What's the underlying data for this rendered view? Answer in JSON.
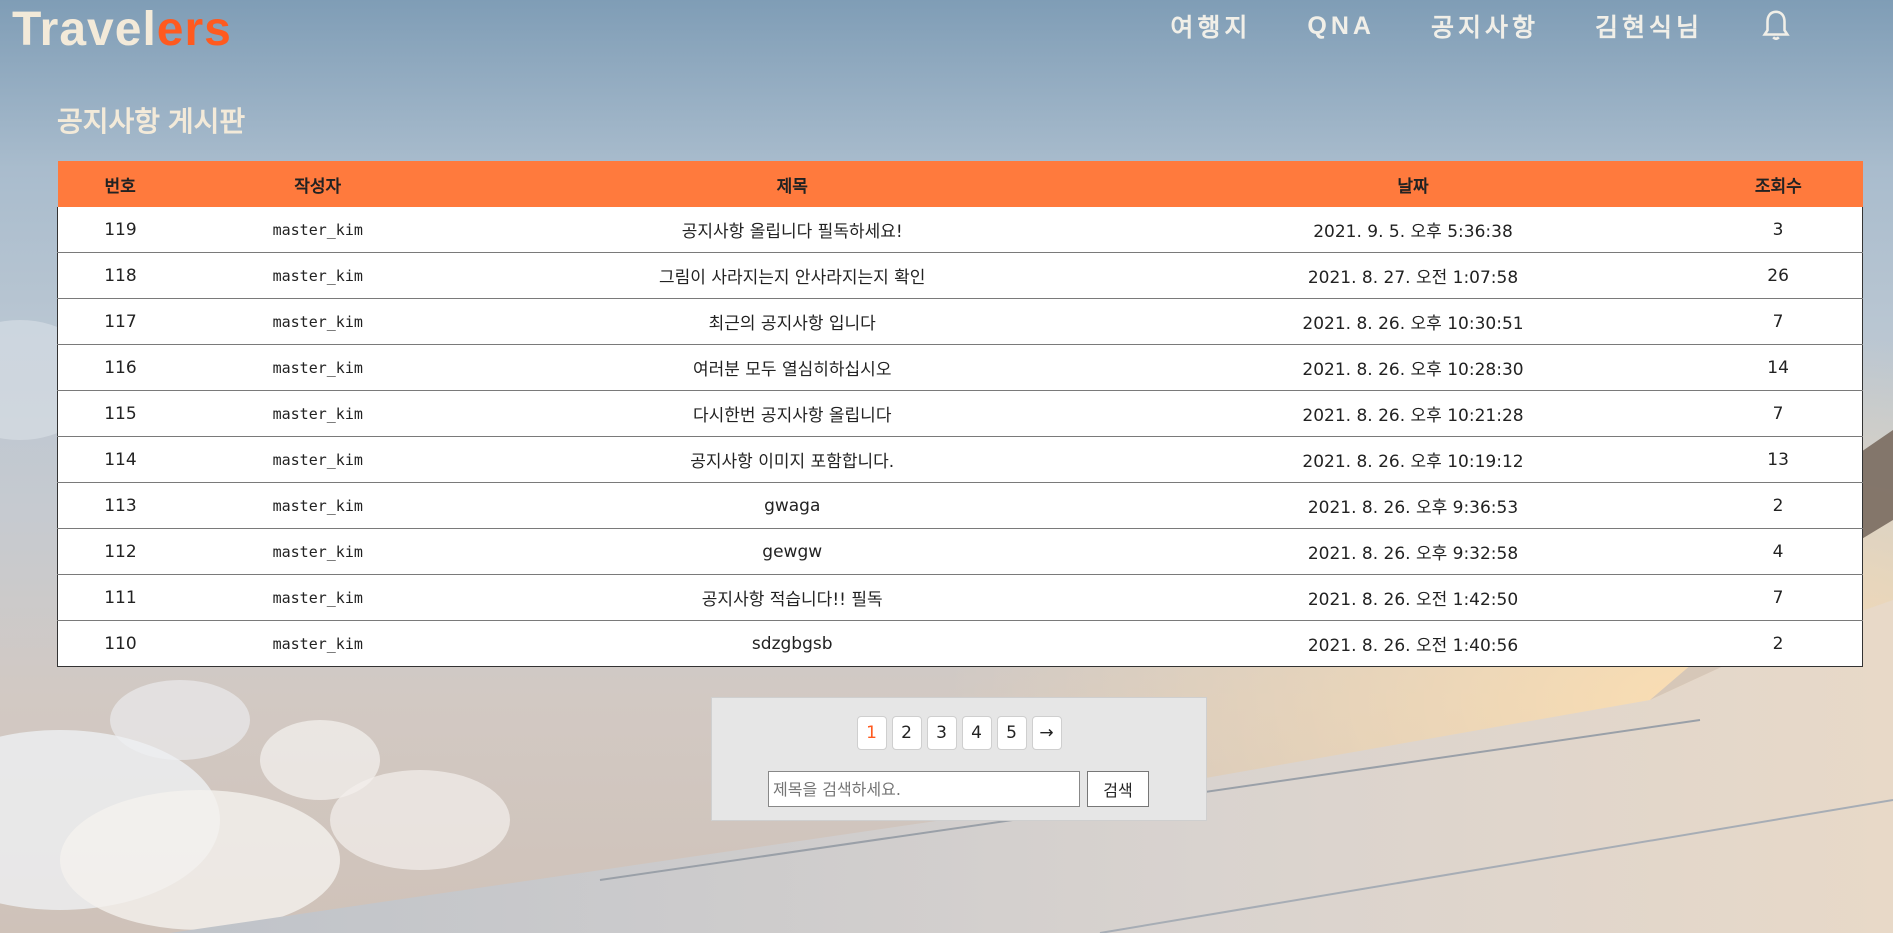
{
  "header": {
    "logo_part1": "Travel",
    "logo_part2": "ers",
    "nav": [
      "여행지",
      "QNA",
      "공지사항",
      "김현식님"
    ],
    "bell_icon": "bell-icon"
  },
  "page_title": "공지사항 게시판",
  "table": {
    "columns": [
      "번호",
      "작성자",
      "제목",
      "날짜",
      "조회수"
    ],
    "rows": [
      {
        "num": "119",
        "author": "master_kim",
        "title": "공지사항 올립니다 필독하세요!",
        "date": "2021. 9. 5. 오후 5:36:38",
        "views": "3"
      },
      {
        "num": "118",
        "author": "master_kim",
        "title": "그림이 사라지는지 안사라지는지 확인",
        "date": "2021. 8. 27. 오전 1:07:58",
        "views": "26"
      },
      {
        "num": "117",
        "author": "master_kim",
        "title": "최근의 공지사항 입니다",
        "date": "2021. 8. 26. 오후 10:30:51",
        "views": "7"
      },
      {
        "num": "116",
        "author": "master_kim",
        "title": "여러분 모두 열심히하십시오",
        "date": "2021. 8. 26. 오후 10:28:30",
        "views": "14"
      },
      {
        "num": "115",
        "author": "master_kim",
        "title": "다시한번 공지사항 올립니다",
        "date": "2021. 8. 26. 오후 10:21:28",
        "views": "7"
      },
      {
        "num": "114",
        "author": "master_kim",
        "title": "공지사항 이미지 포함합니다.",
        "date": "2021. 8. 26. 오후 10:19:12",
        "views": "13"
      },
      {
        "num": "113",
        "author": "master_kim",
        "title": "gwaga",
        "date": "2021. 8. 26. 오후 9:36:53",
        "views": "2"
      },
      {
        "num": "112",
        "author": "master_kim",
        "title": "gewgw",
        "date": "2021. 8. 26. 오후 9:32:58",
        "views": "4"
      },
      {
        "num": "111",
        "author": "master_kim",
        "title": "공지사항 적습니다!! 필독",
        "date": "2021. 8. 26. 오전 1:42:50",
        "views": "7"
      },
      {
        "num": "110",
        "author": "master_kim",
        "title": "sdzgbgsb",
        "date": "2021. 8. 26. 오전 1:40:56",
        "views": "2"
      }
    ]
  },
  "pagination": {
    "pages": [
      "1",
      "2",
      "3",
      "4",
      "5"
    ],
    "current": "1",
    "next": "→"
  },
  "search": {
    "placeholder": "제목을 검색하세요.",
    "button": "검색"
  },
  "colors": {
    "accent": "#ff7a3d",
    "logo_accent": "#ff5a1f",
    "logo_base": "#f3ead9"
  }
}
